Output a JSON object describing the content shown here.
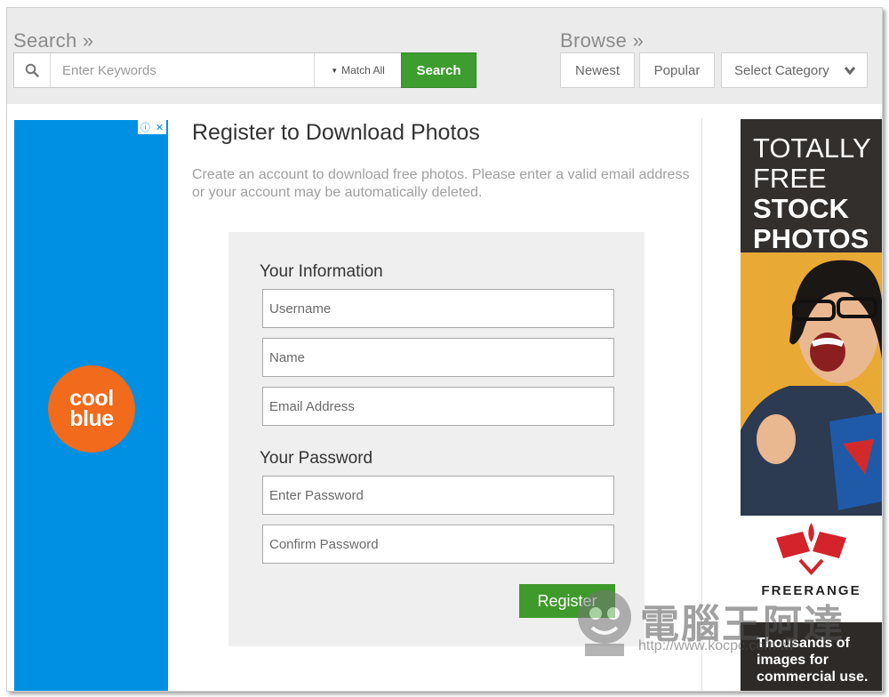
{
  "search": {
    "label": "Search »",
    "placeholder": "Enter Keywords",
    "match_label": "Match All",
    "button_label": "Search"
  },
  "browse": {
    "label": "Browse »",
    "newest": "Newest",
    "popular": "Popular",
    "category": "Select Category"
  },
  "left_ad": {
    "brand_line1": "cool",
    "brand_line2": "blue",
    "info_icon": "ⓘ",
    "close_icon": "✕"
  },
  "main": {
    "title": "Register to Download Photos",
    "description": "Create an account to download free photos. Please enter a valid email address or your account may be automatically deleted.",
    "info_heading": "Your Information",
    "username_placeholder": "Username",
    "name_placeholder": "Name",
    "email_placeholder": "Email Address",
    "password_heading": "Your Password",
    "password_placeholder": "Enter Password",
    "confirm_placeholder": "Confirm Password",
    "register_label": "Register"
  },
  "right_ad": {
    "line1": "TOTALLY",
    "line2": "FREE",
    "line3": "STOCK",
    "line4": "PHOTOS",
    "brand": "FREERANGE",
    "tag1": "Thousands of",
    "tag2": "images for",
    "tag3": "commercial use."
  },
  "watermark": {
    "text": "電腦王阿達",
    "url": "http://www.kocpc.com.tw"
  },
  "colors": {
    "accent_green": "#3d9d2f",
    "ad_blue": "#0090e3",
    "coolblue_orange": "#f26a1b"
  }
}
